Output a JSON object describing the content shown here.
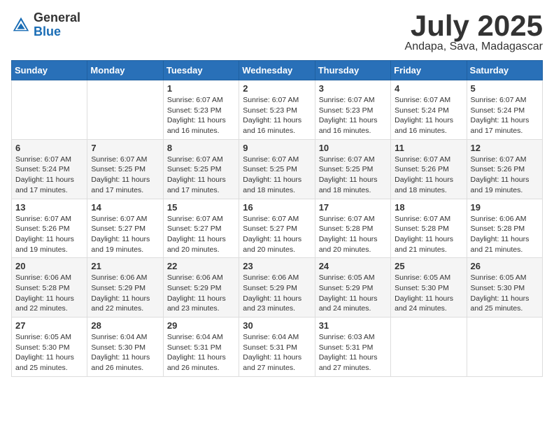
{
  "logo": {
    "general": "General",
    "blue": "Blue"
  },
  "title": {
    "month": "July 2025",
    "location": "Andapa, Sava, Madagascar"
  },
  "weekdays": [
    "Sunday",
    "Monday",
    "Tuesday",
    "Wednesday",
    "Thursday",
    "Friday",
    "Saturday"
  ],
  "weeks": [
    [
      {
        "day": "",
        "sunrise": "",
        "sunset": "",
        "daylight": ""
      },
      {
        "day": "",
        "sunrise": "",
        "sunset": "",
        "daylight": ""
      },
      {
        "day": "1",
        "sunrise": "Sunrise: 6:07 AM",
        "sunset": "Sunset: 5:23 PM",
        "daylight": "Daylight: 11 hours and 16 minutes."
      },
      {
        "day": "2",
        "sunrise": "Sunrise: 6:07 AM",
        "sunset": "Sunset: 5:23 PM",
        "daylight": "Daylight: 11 hours and 16 minutes."
      },
      {
        "day": "3",
        "sunrise": "Sunrise: 6:07 AM",
        "sunset": "Sunset: 5:23 PM",
        "daylight": "Daylight: 11 hours and 16 minutes."
      },
      {
        "day": "4",
        "sunrise": "Sunrise: 6:07 AM",
        "sunset": "Sunset: 5:24 PM",
        "daylight": "Daylight: 11 hours and 16 minutes."
      },
      {
        "day": "5",
        "sunrise": "Sunrise: 6:07 AM",
        "sunset": "Sunset: 5:24 PM",
        "daylight": "Daylight: 11 hours and 17 minutes."
      }
    ],
    [
      {
        "day": "6",
        "sunrise": "Sunrise: 6:07 AM",
        "sunset": "Sunset: 5:24 PM",
        "daylight": "Daylight: 11 hours and 17 minutes."
      },
      {
        "day": "7",
        "sunrise": "Sunrise: 6:07 AM",
        "sunset": "Sunset: 5:25 PM",
        "daylight": "Daylight: 11 hours and 17 minutes."
      },
      {
        "day": "8",
        "sunrise": "Sunrise: 6:07 AM",
        "sunset": "Sunset: 5:25 PM",
        "daylight": "Daylight: 11 hours and 17 minutes."
      },
      {
        "day": "9",
        "sunrise": "Sunrise: 6:07 AM",
        "sunset": "Sunset: 5:25 PM",
        "daylight": "Daylight: 11 hours and 18 minutes."
      },
      {
        "day": "10",
        "sunrise": "Sunrise: 6:07 AM",
        "sunset": "Sunset: 5:25 PM",
        "daylight": "Daylight: 11 hours and 18 minutes."
      },
      {
        "day": "11",
        "sunrise": "Sunrise: 6:07 AM",
        "sunset": "Sunset: 5:26 PM",
        "daylight": "Daylight: 11 hours and 18 minutes."
      },
      {
        "day": "12",
        "sunrise": "Sunrise: 6:07 AM",
        "sunset": "Sunset: 5:26 PM",
        "daylight": "Daylight: 11 hours and 19 minutes."
      }
    ],
    [
      {
        "day": "13",
        "sunrise": "Sunrise: 6:07 AM",
        "sunset": "Sunset: 5:26 PM",
        "daylight": "Daylight: 11 hours and 19 minutes."
      },
      {
        "day": "14",
        "sunrise": "Sunrise: 6:07 AM",
        "sunset": "Sunset: 5:27 PM",
        "daylight": "Daylight: 11 hours and 19 minutes."
      },
      {
        "day": "15",
        "sunrise": "Sunrise: 6:07 AM",
        "sunset": "Sunset: 5:27 PM",
        "daylight": "Daylight: 11 hours and 20 minutes."
      },
      {
        "day": "16",
        "sunrise": "Sunrise: 6:07 AM",
        "sunset": "Sunset: 5:27 PM",
        "daylight": "Daylight: 11 hours and 20 minutes."
      },
      {
        "day": "17",
        "sunrise": "Sunrise: 6:07 AM",
        "sunset": "Sunset: 5:28 PM",
        "daylight": "Daylight: 11 hours and 20 minutes."
      },
      {
        "day": "18",
        "sunrise": "Sunrise: 6:07 AM",
        "sunset": "Sunset: 5:28 PM",
        "daylight": "Daylight: 11 hours and 21 minutes."
      },
      {
        "day": "19",
        "sunrise": "Sunrise: 6:06 AM",
        "sunset": "Sunset: 5:28 PM",
        "daylight": "Daylight: 11 hours and 21 minutes."
      }
    ],
    [
      {
        "day": "20",
        "sunrise": "Sunrise: 6:06 AM",
        "sunset": "Sunset: 5:28 PM",
        "daylight": "Daylight: 11 hours and 22 minutes."
      },
      {
        "day": "21",
        "sunrise": "Sunrise: 6:06 AM",
        "sunset": "Sunset: 5:29 PM",
        "daylight": "Daylight: 11 hours and 22 minutes."
      },
      {
        "day": "22",
        "sunrise": "Sunrise: 6:06 AM",
        "sunset": "Sunset: 5:29 PM",
        "daylight": "Daylight: 11 hours and 23 minutes."
      },
      {
        "day": "23",
        "sunrise": "Sunrise: 6:06 AM",
        "sunset": "Sunset: 5:29 PM",
        "daylight": "Daylight: 11 hours and 23 minutes."
      },
      {
        "day": "24",
        "sunrise": "Sunrise: 6:05 AM",
        "sunset": "Sunset: 5:29 PM",
        "daylight": "Daylight: 11 hours and 24 minutes."
      },
      {
        "day": "25",
        "sunrise": "Sunrise: 6:05 AM",
        "sunset": "Sunset: 5:30 PM",
        "daylight": "Daylight: 11 hours and 24 minutes."
      },
      {
        "day": "26",
        "sunrise": "Sunrise: 6:05 AM",
        "sunset": "Sunset: 5:30 PM",
        "daylight": "Daylight: 11 hours and 25 minutes."
      }
    ],
    [
      {
        "day": "27",
        "sunrise": "Sunrise: 6:05 AM",
        "sunset": "Sunset: 5:30 PM",
        "daylight": "Daylight: 11 hours and 25 minutes."
      },
      {
        "day": "28",
        "sunrise": "Sunrise: 6:04 AM",
        "sunset": "Sunset: 5:30 PM",
        "daylight": "Daylight: 11 hours and 26 minutes."
      },
      {
        "day": "29",
        "sunrise": "Sunrise: 6:04 AM",
        "sunset": "Sunset: 5:31 PM",
        "daylight": "Daylight: 11 hours and 26 minutes."
      },
      {
        "day": "30",
        "sunrise": "Sunrise: 6:04 AM",
        "sunset": "Sunset: 5:31 PM",
        "daylight": "Daylight: 11 hours and 27 minutes."
      },
      {
        "day": "31",
        "sunrise": "Sunrise: 6:03 AM",
        "sunset": "Sunset: 5:31 PM",
        "daylight": "Daylight: 11 hours and 27 minutes."
      },
      {
        "day": "",
        "sunrise": "",
        "sunset": "",
        "daylight": ""
      },
      {
        "day": "",
        "sunrise": "",
        "sunset": "",
        "daylight": ""
      }
    ]
  ]
}
